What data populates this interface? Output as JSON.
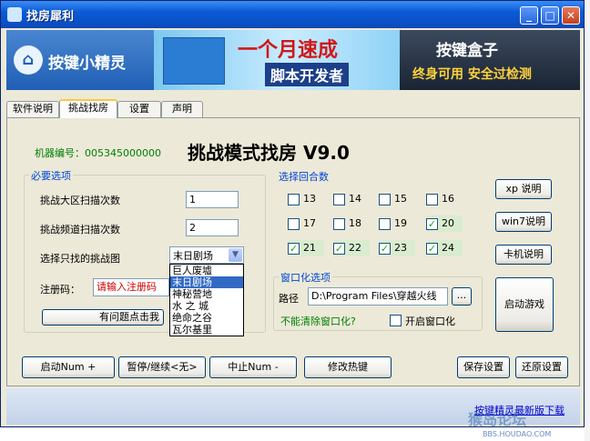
{
  "window": {
    "title": "找房犀利",
    "min": "_",
    "max": "□",
    "close": "✕"
  },
  "banner": {
    "logo_text": "按键小精灵",
    "ad_line1": "一个月速成",
    "ad_line2": "脚本开发者",
    "ad_right_title": "按键盒子",
    "ad_right_sub": "终身可用  安全过检测"
  },
  "tabs": [
    "软件说明",
    "挑战找房",
    "设置",
    "声明"
  ],
  "main": {
    "machine_label": "机器编号：005345000000",
    "title": "挑战模式找房 V9.0",
    "required_group": "必要选项",
    "region_scan_label": "挑战大区扫描次数",
    "region_scan_value": "1",
    "channel_scan_label": "挑战频道扫描次数",
    "channel_scan_value": "2",
    "map_label": "选择只找的挑战图",
    "map_selected": "末日剧场",
    "map_options": [
      "巨人废墟",
      "末日剧场",
      "神秘营地",
      "水 之 城",
      "绝命之谷",
      "瓦尔基里"
    ],
    "reg_label": "注册码：",
    "reg_placeholder": "请输入注册码",
    "help_button": "有问题点击我",
    "rounds_group": "选择回合数",
    "rounds": [
      {
        "label": "13",
        "checked": false
      },
      {
        "label": "14",
        "checked": false
      },
      {
        "label": "15",
        "checked": false
      },
      {
        "label": "16",
        "checked": false
      },
      {
        "label": "17",
        "checked": false
      },
      {
        "label": "18",
        "checked": false
      },
      {
        "label": "19",
        "checked": false
      },
      {
        "label": "20",
        "checked": true
      },
      {
        "label": "21",
        "checked": true
      },
      {
        "label": "22",
        "checked": true
      },
      {
        "label": "23",
        "checked": true
      },
      {
        "label": "24",
        "checked": true
      }
    ],
    "window_group": "窗口化选项",
    "path_label": "路径",
    "path_value": "D:\\Program Files\\穿越火线",
    "browse_label": "...",
    "cannot_clear": "不能清除窗口化?",
    "open_window_label": "开启窗口化",
    "side_buttons": [
      "xp  说明",
      "win7说明",
      "卡机说明"
    ],
    "start_game": "启动游戏",
    "bottom_buttons": [
      "启动Num +",
      "暂停/继续<无>",
      "中止Num -",
      "修改热键",
      "保存设置",
      "还原设置"
    ]
  },
  "footer": {
    "link": "按键精灵最新版下载",
    "watermark": "猴岛论坛",
    "watermark_url": "BBS.HOUDAO.COM"
  }
}
